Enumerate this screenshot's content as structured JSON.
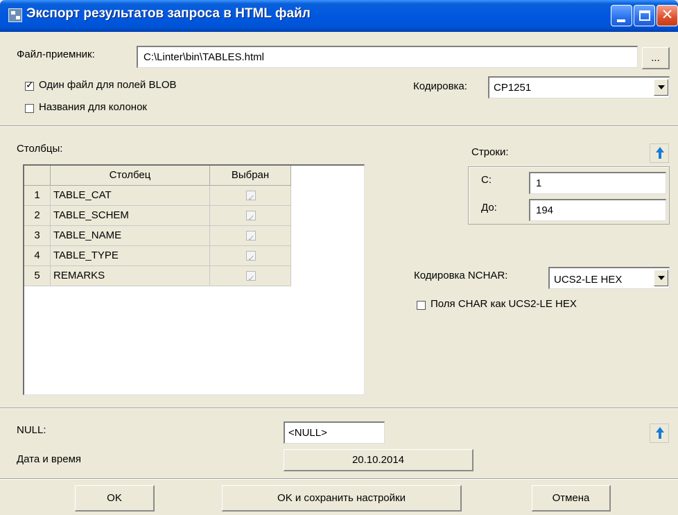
{
  "window": {
    "title": "Экспорт результатов запроса в HTML файл"
  },
  "file": {
    "label": "Файл-приемник:",
    "value": "C:\\Linter\\bin\\TABLES.html",
    "browse_label": "..."
  },
  "options": {
    "blob_single_file": {
      "label": "Один файл для полей BLOB",
      "checked": true
    },
    "column_names": {
      "label": "Названия для колонок",
      "checked": false
    }
  },
  "encoding": {
    "label": "Кодировка:",
    "value": "CP1251"
  },
  "columns": {
    "label": "Столбцы:",
    "headers": [
      "Столбец",
      "Выбран"
    ],
    "rows": [
      {
        "num": "1",
        "name": "TABLE_CAT",
        "selected": true
      },
      {
        "num": "2",
        "name": "TABLE_SCHEM",
        "selected": true
      },
      {
        "num": "3",
        "name": "TABLE_NAME",
        "selected": true
      },
      {
        "num": "4",
        "name": "TABLE_TYPE",
        "selected": true
      },
      {
        "num": "5",
        "name": "REMARKS",
        "selected": true
      }
    ]
  },
  "rows_range": {
    "label": "Строки:",
    "from_label": "С:",
    "from_value": "1",
    "to_label": "До:",
    "to_value": "194"
  },
  "nchar": {
    "label": "Кодировка NCHAR:",
    "value": "UCS2-LE HEX",
    "char_as_ucs2": {
      "label": "Поля CHAR как UCS2-LE HEX",
      "checked": false
    }
  },
  "null_section": {
    "label": "NULL:",
    "value": "<NULL>",
    "datetime_label": "Дата и время",
    "datetime_value": "20.10.2014"
  },
  "buttons": {
    "ok": "OK",
    "ok_save": "OK и сохранить настройки",
    "cancel": "Отмена"
  },
  "icons": {
    "window_icon": "app-icon",
    "collapse_icon": "arrow-up-icon"
  }
}
